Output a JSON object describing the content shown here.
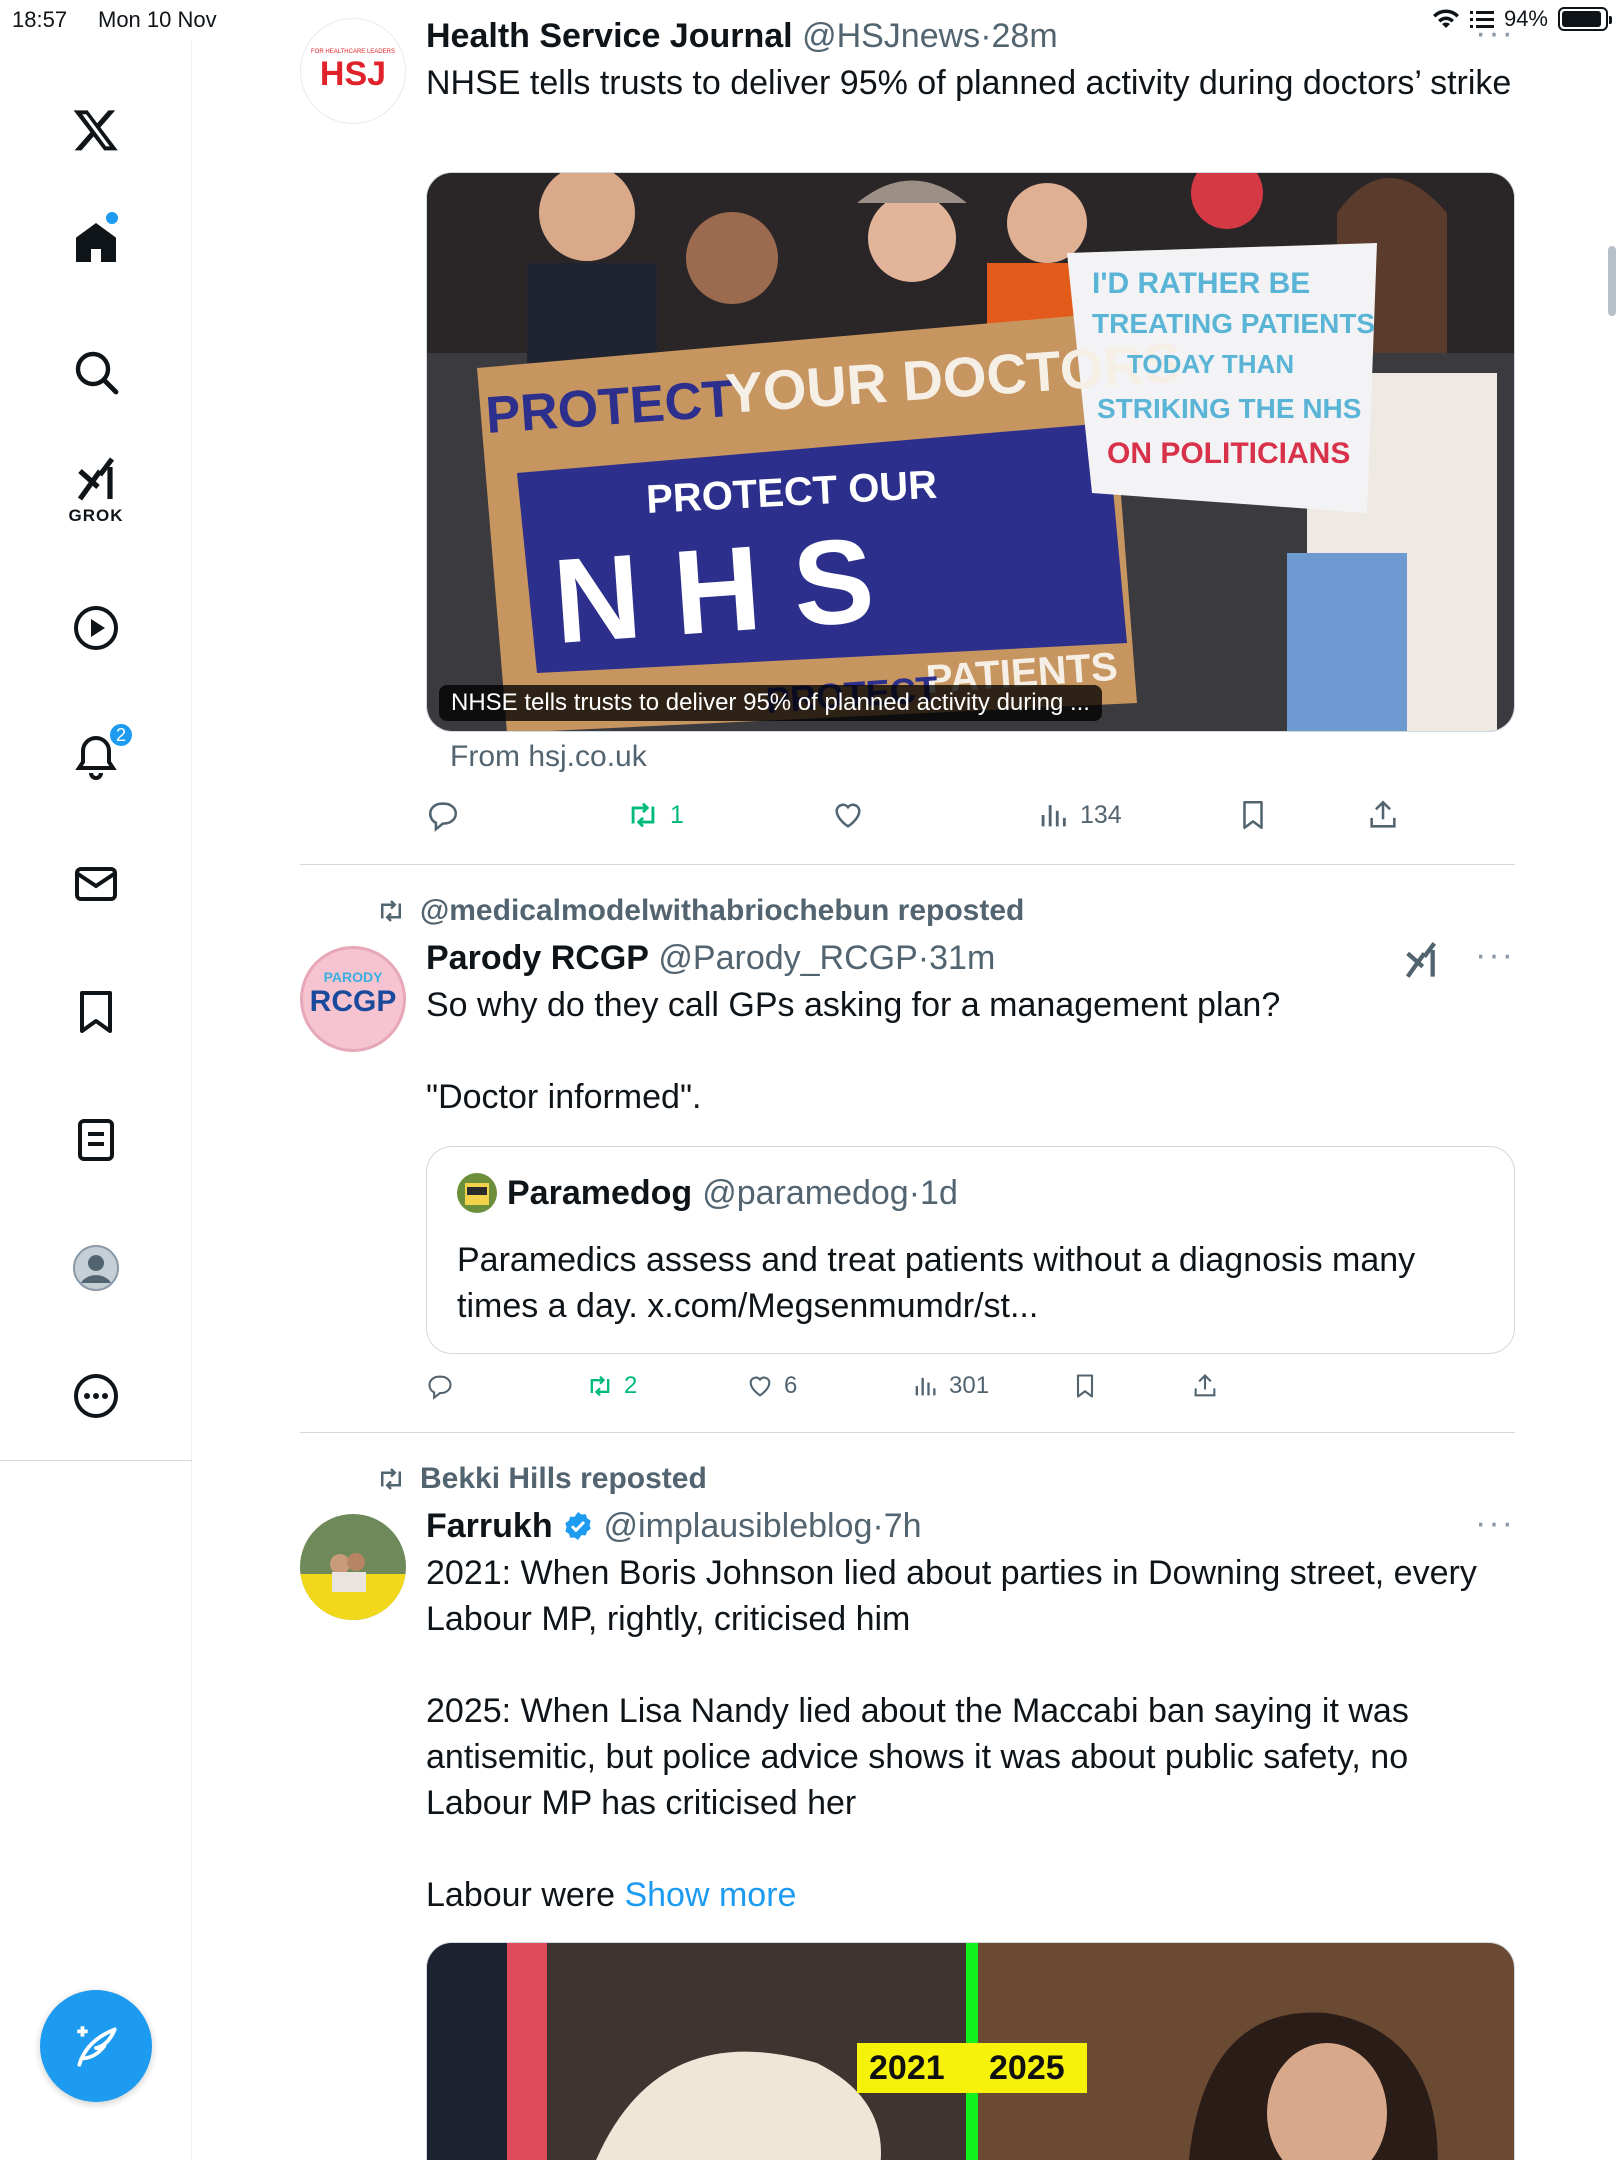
{
  "status": {
    "time": "18:57",
    "date": "Mon 10 Nov",
    "battery": "94%",
    "battery_level": 0.94
  },
  "sidebar": {
    "items": [
      {
        "name": "logo",
        "icon": "x-logo-icon"
      },
      {
        "name": "home",
        "icon": "home-icon",
        "has_dot": true
      },
      {
        "name": "search",
        "icon": "search-icon"
      },
      {
        "name": "grok",
        "icon": "grok-icon",
        "label": "GROK"
      },
      {
        "name": "video",
        "icon": "play-icon"
      },
      {
        "name": "notifications",
        "icon": "bell-icon",
        "badge": "2"
      },
      {
        "name": "messages",
        "icon": "mail-icon"
      },
      {
        "name": "bookmarks",
        "icon": "bookmark-icon"
      },
      {
        "name": "lists",
        "icon": "list-icon"
      },
      {
        "name": "profile",
        "icon": "profile-avatar"
      },
      {
        "name": "more",
        "icon": "more-circle-icon"
      }
    ],
    "compose_icon": "compose-icon"
  },
  "posts": [
    {
      "name": "Health Service Journal",
      "handle": "@HSJnews",
      "time": "28m",
      "avatar_text": "HSJ",
      "avatar_small": "FOR HEALTHCARE LEADERS",
      "text": "NHSE tells trusts to deliver 95% of planned activity during doctors’ strike",
      "card": {
        "caption": "NHSE tells trusts to deliver 95% of planned activity during ...",
        "from": "From hsj.co.uk",
        "signs": [
          "PROTECT",
          "YOUR DOCTORS",
          "PROTECT OUR",
          "N H S",
          "PATIENTS",
          "PROTECT",
          "I'D RATHER BE",
          "TREATING PATIENTS",
          "TODAY THAN",
          "STRIKING THE NHS",
          "ON POLITICIANS"
        ]
      },
      "stats": {
        "reposts": "1",
        "views": "134"
      }
    },
    {
      "reposted_by": "@medicalmodelwithabriochebun reposted",
      "name": "Parody RCGP",
      "handle": "@Parody_RCGP",
      "time": "31m",
      "avatar_top": "PARODY",
      "avatar_text": "RCGP",
      "text1": "So why do they call GPs asking for a management plan?",
      "text2": "\"Doctor informed\".",
      "quote": {
        "name": "Paramedog",
        "handle": "@paramedog",
        "time": "1d",
        "text": "Paramedics assess and treat patients without a diagnosis many times a day. x.com/Megsenmumdr/st..."
      },
      "stats": {
        "reposts": "2",
        "likes": "6",
        "views": "301"
      }
    },
    {
      "reposted_by": "Bekki Hills reposted",
      "name": "Farrukh",
      "handle": "@implausibleblog",
      "time": "7h",
      "verified": true,
      "text1": "2021: When Boris Johnson lied about parties in Downing street, every Labour MP, rightly, criticised him",
      "text2": "2025: When Lisa Nandy lied about the Maccabi ban saying it was antisemitic, but police advice shows it was about public safety, no Labour MP has criticised her",
      "text3_prefix": "Labour were ",
      "show_more": "Show more",
      "image_labels": [
        "2021",
        "2025"
      ]
    }
  ]
}
